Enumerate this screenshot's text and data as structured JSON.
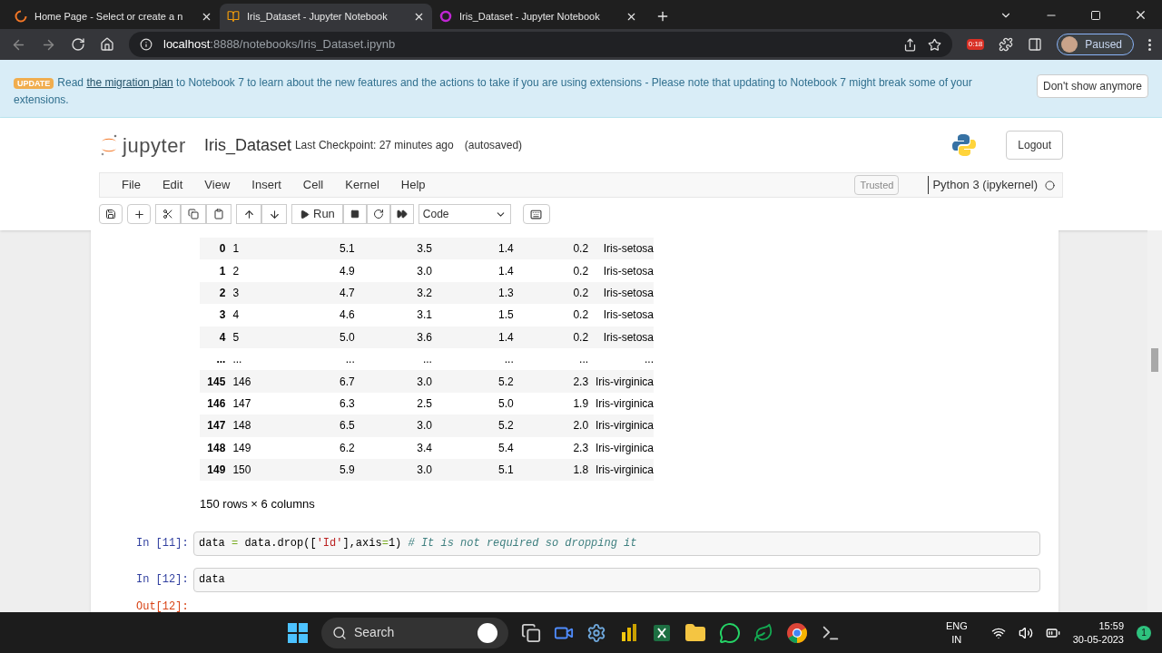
{
  "browser": {
    "tabs": [
      {
        "title": "Home Page - Select or create a n",
        "selected": false,
        "kind": "spinner"
      },
      {
        "title": "Iris_Dataset - Jupyter Notebook",
        "selected": true,
        "kind": "book"
      },
      {
        "title": "Iris_Dataset - Jupyter Notebook",
        "selected": false,
        "kind": "ring"
      }
    ],
    "url_host": "localhost",
    "url_rest": ":8888/notebooks/Iris_Dataset.ipynb",
    "extension_badge": "0:18",
    "profile_status": "Paused"
  },
  "banner": {
    "badge": "UPDATE",
    "before": "Read ",
    "link": "the migration plan",
    "after": " to Notebook 7 to learn about the new features and the actions to take if you are using extensions - Please note that updating to Notebook 7 might break some of your extensions.",
    "dismiss": "Don't show anymore"
  },
  "header": {
    "logo": "jupyter",
    "notebook_name": "Iris_Dataset",
    "checkpoint": "Last Checkpoint: 27 minutes ago",
    "autosave": "(autosaved)",
    "logout": "Logout"
  },
  "menu": [
    "File",
    "Edit",
    "View",
    "Insert",
    "Cell",
    "Kernel",
    "Help"
  ],
  "trusted": "Trusted",
  "kernel": "Python 3 (ipykernel)",
  "toolbar": {
    "run": "Run",
    "cell_type": "Code"
  },
  "table": {
    "rows": [
      {
        "index": "0",
        "cells": [
          "1",
          "5.1",
          "3.5",
          "1.4",
          "0.2",
          "Iris-setosa"
        ]
      },
      {
        "index": "1",
        "cells": [
          "2",
          "4.9",
          "3.0",
          "1.4",
          "0.2",
          "Iris-setosa"
        ]
      },
      {
        "index": "2",
        "cells": [
          "3",
          "4.7",
          "3.2",
          "1.3",
          "0.2",
          "Iris-setosa"
        ]
      },
      {
        "index": "3",
        "cells": [
          "4",
          "4.6",
          "3.1",
          "1.5",
          "0.2",
          "Iris-setosa"
        ]
      },
      {
        "index": "4",
        "cells": [
          "5",
          "5.0",
          "3.6",
          "1.4",
          "0.2",
          "Iris-setosa"
        ]
      },
      {
        "index": "...",
        "cells": [
          "...",
          "...",
          "...",
          "...",
          "...",
          "..."
        ]
      },
      {
        "index": "145",
        "cells": [
          "146",
          "6.7",
          "3.0",
          "5.2",
          "2.3",
          "Iris-virginica"
        ]
      },
      {
        "index": "146",
        "cells": [
          "147",
          "6.3",
          "2.5",
          "5.0",
          "1.9",
          "Iris-virginica"
        ]
      },
      {
        "index": "147",
        "cells": [
          "148",
          "6.5",
          "3.0",
          "5.2",
          "2.0",
          "Iris-virginica"
        ]
      },
      {
        "index": "148",
        "cells": [
          "149",
          "6.2",
          "3.4",
          "5.4",
          "2.3",
          "Iris-virginica"
        ]
      },
      {
        "index": "149",
        "cells": [
          "150",
          "5.9",
          "3.0",
          "5.1",
          "1.8",
          "Iris-virginica"
        ]
      }
    ],
    "summary": "150 rows × 6 columns"
  },
  "cells": [
    {
      "prompt": "In [11]:",
      "tokens": [
        {
          "kind": "name",
          "text": "data "
        },
        {
          "kind": "op",
          "text": "="
        },
        {
          "kind": "name",
          "text": " data.drop(["
        },
        {
          "kind": "string",
          "text": "'Id'"
        },
        {
          "kind": "name",
          "text": "],axis"
        },
        {
          "kind": "op",
          "text": "="
        },
        {
          "kind": "name",
          "text": "1) "
        },
        {
          "kind": "comment",
          "text": "# It is not required so dropping it"
        }
      ]
    },
    {
      "prompt": "In [12]:",
      "tokens": [
        {
          "kind": "name",
          "text": "data"
        }
      ]
    }
  ],
  "output_prompt": "Out[12]:",
  "taskbar": {
    "search": "Search",
    "language": "ENG",
    "region": "IN",
    "time": "15:59",
    "date": "30-05-2023",
    "notifications": "1"
  }
}
